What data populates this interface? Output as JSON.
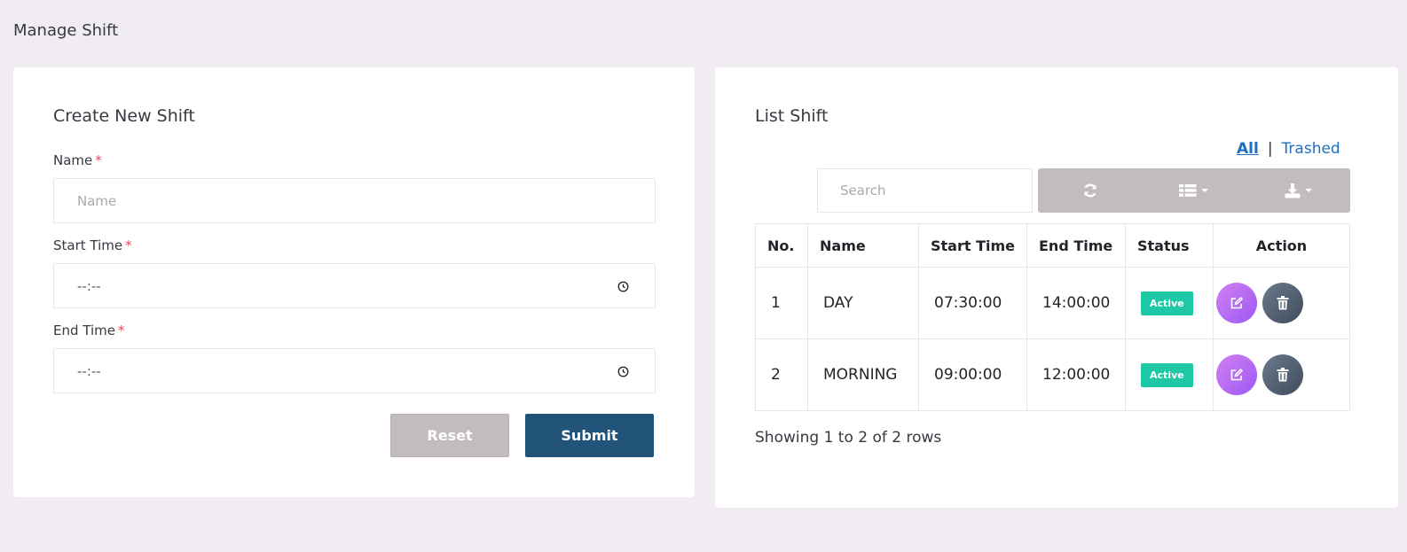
{
  "page": {
    "title": "Manage Shift"
  },
  "form": {
    "title": "Create New Shift",
    "name_label": "Name",
    "name_placeholder": "Name",
    "start_label": "Start Time",
    "start_value": "--:--",
    "end_label": "End Time",
    "end_value": "--:--",
    "required_mark": "*",
    "reset_label": "Reset",
    "submit_label": "Submit"
  },
  "list": {
    "title": "List Shift",
    "filter_all": "All",
    "filter_sep": "|",
    "filter_trashed": "Trashed",
    "search_placeholder": "Search",
    "columns": [
      "No.",
      "Name",
      "Start Time",
      "End Time",
      "Status",
      "Action"
    ],
    "rows": [
      {
        "no": "1",
        "name": "DAY",
        "start": "07:30:00",
        "end": "14:00:00",
        "status": "Active"
      },
      {
        "no": "2",
        "name": "MORNING",
        "start": "09:00:00",
        "end": "12:00:00",
        "status": "Active"
      }
    ],
    "pagination_text": "Showing 1 to 2 of 2 rows"
  },
  "colors": {
    "background": "#f1ecf2",
    "submit": "#22547a",
    "reset": "#c2bcbc",
    "status_active": "#1fc8a5",
    "link": "#1d6fc2"
  },
  "icons": [
    "clock-icon",
    "refresh-icon",
    "columns-icon",
    "download-icon",
    "edit-icon",
    "trash-icon"
  ]
}
